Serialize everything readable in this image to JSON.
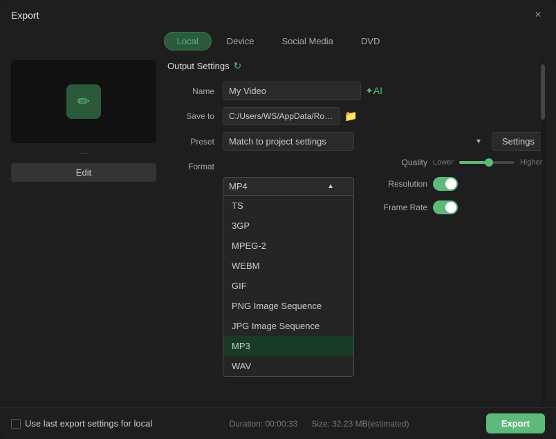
{
  "window": {
    "title": "Export",
    "close_label": "×"
  },
  "tabs": [
    {
      "id": "local",
      "label": "Local",
      "active": true
    },
    {
      "id": "device",
      "label": "Device",
      "active": false
    },
    {
      "id": "social-media",
      "label": "Social Media",
      "active": false
    },
    {
      "id": "dvd",
      "label": "DVD",
      "active": false
    }
  ],
  "preview": {
    "edit_label": "Edit",
    "icon": "✏"
  },
  "output_settings": {
    "header": "Output Settings",
    "name_label": "Name",
    "name_value": "My Video",
    "save_to_label": "Save to",
    "save_to_value": "C:/Users/WS/AppData/Roami...",
    "preset_label": "Preset",
    "preset_value": "Match to project settings",
    "settings_label": "Settings",
    "format_label": "Format",
    "format_value": "MP4",
    "quality_label": "Quality",
    "quality_left": "Lower",
    "quality_right": "Higher",
    "resolution_label": "Resolution",
    "frame_rate_label": "Frame Rate"
  },
  "format_options": [
    {
      "value": "TS",
      "label": "TS",
      "selected": false
    },
    {
      "value": "3GP",
      "label": "3GP",
      "selected": false
    },
    {
      "value": "MPEG-2",
      "label": "MPEG-2",
      "selected": false
    },
    {
      "value": "WEBM",
      "label": "WEBM",
      "selected": false
    },
    {
      "value": "GIF",
      "label": "GIF",
      "selected": false
    },
    {
      "value": "PNG Image Sequence",
      "label": "PNG Image Sequence",
      "selected": false
    },
    {
      "value": "JPG Image Sequence",
      "label": "JPG Image Sequence",
      "selected": false
    },
    {
      "value": "MP3",
      "label": "MP3",
      "selected": true
    },
    {
      "value": "WAV",
      "label": "WAV",
      "selected": false
    }
  ],
  "toggles": [
    {
      "id": "toggle1",
      "on": true
    },
    {
      "id": "toggle2",
      "on": true
    }
  ],
  "bottom": {
    "checkbox_label": "Use last export settings for local",
    "duration_label": "Duration: 00:00:33",
    "size_label": "Size: 32.23 MB(estimated)",
    "export_label": "Export"
  }
}
